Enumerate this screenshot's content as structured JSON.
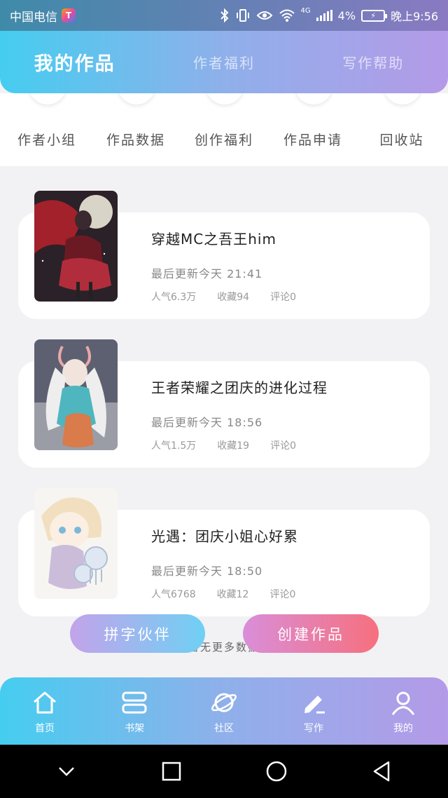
{
  "status_bar": {
    "carrier": "中国电信",
    "network": "4G",
    "battery_percent": "4%",
    "time": "晚上9:56"
  },
  "header": {
    "tabs": [
      {
        "label": "我的作品",
        "active": true
      },
      {
        "label": "作者福利",
        "active": false
      },
      {
        "label": "写作帮助",
        "active": false
      }
    ]
  },
  "shortcuts": [
    {
      "label": "作者小组"
    },
    {
      "label": "作品数据"
    },
    {
      "label": "创作福利"
    },
    {
      "label": "作品申请"
    },
    {
      "label": "回收站"
    }
  ],
  "works": [
    {
      "title": "穿越MC之吾王him",
      "updated": "最后更新今天 21:41",
      "popularity": "人气6.3万",
      "favorites": "收藏94",
      "comments": "评论0",
      "cover_icon": "cover-art-red-dress-girl"
    },
    {
      "title": "王者荣耀之团庆的进化过程",
      "updated": "最后更新今天 18:56",
      "popularity": "人气1.5万",
      "favorites": "收藏19",
      "comments": "评论0",
      "cover_icon": "cover-art-antler-girl"
    },
    {
      "title": "光遇：团庆小姐心好累",
      "updated": "最后更新今天 18:50",
      "popularity": "人气6768",
      "favorites": "收藏12",
      "comments": "评论0",
      "cover_icon": "cover-art-chibi-jellyfish"
    }
  ],
  "buttons": {
    "partner": "拼字伙伴",
    "create": "创建作品"
  },
  "more_text": "暂无更多数据",
  "bottom_nav": [
    {
      "label": "首页",
      "icon": "home-icon"
    },
    {
      "label": "书架",
      "icon": "bookshelf-icon"
    },
    {
      "label": "社区",
      "icon": "planet-icon"
    },
    {
      "label": "写作",
      "icon": "pen-icon"
    },
    {
      "label": "我的",
      "icon": "profile-icon"
    }
  ],
  "colors": {
    "accent_start": "#45cdf0",
    "accent_end": "#b49ae8",
    "create_button": "#f6707e"
  }
}
